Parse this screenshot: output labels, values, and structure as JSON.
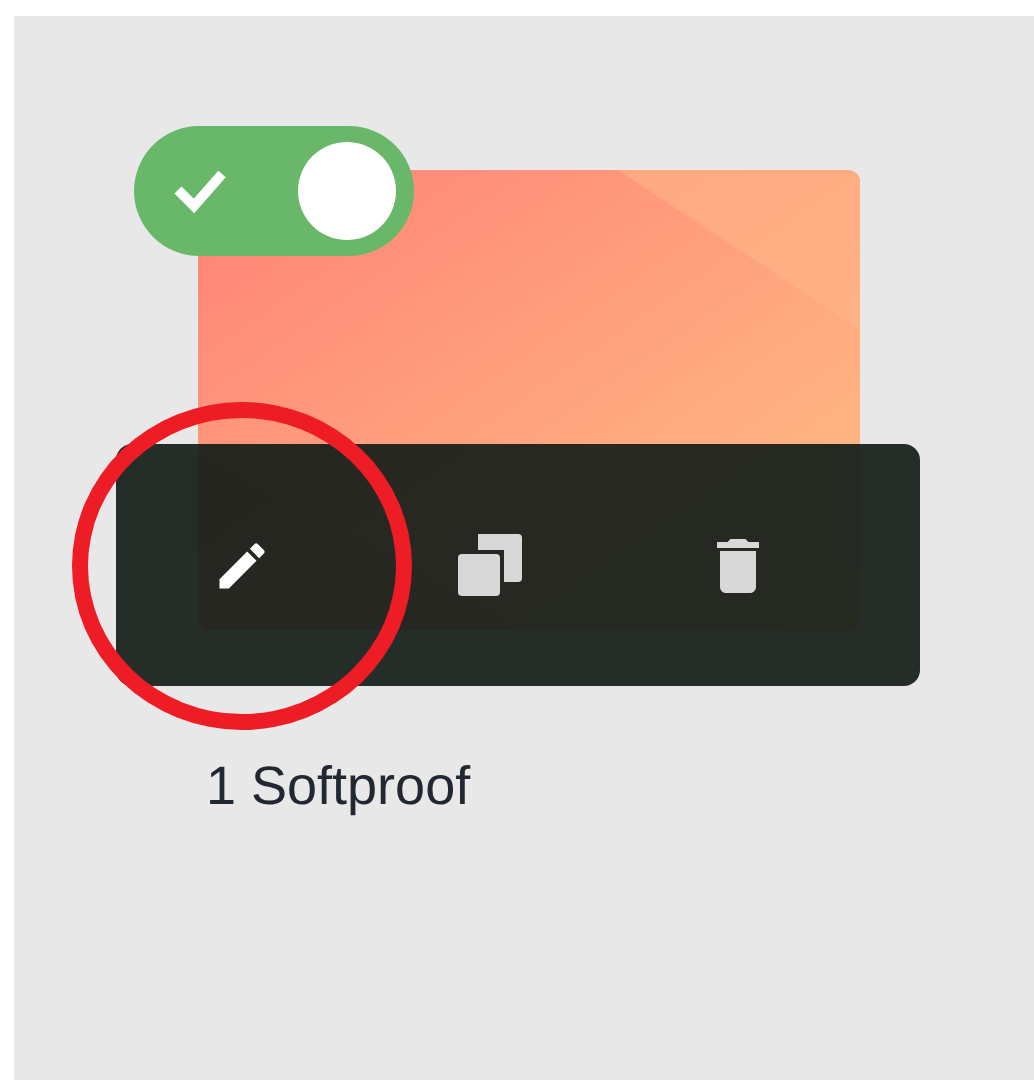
{
  "card": {
    "enabled": true,
    "title": "1 Softproof",
    "actions": [
      {
        "kind": "edit",
        "highlighted": true
      },
      {
        "kind": "duplicate",
        "highlighted": false
      },
      {
        "kind": "delete",
        "highlighted": false
      }
    ]
  }
}
